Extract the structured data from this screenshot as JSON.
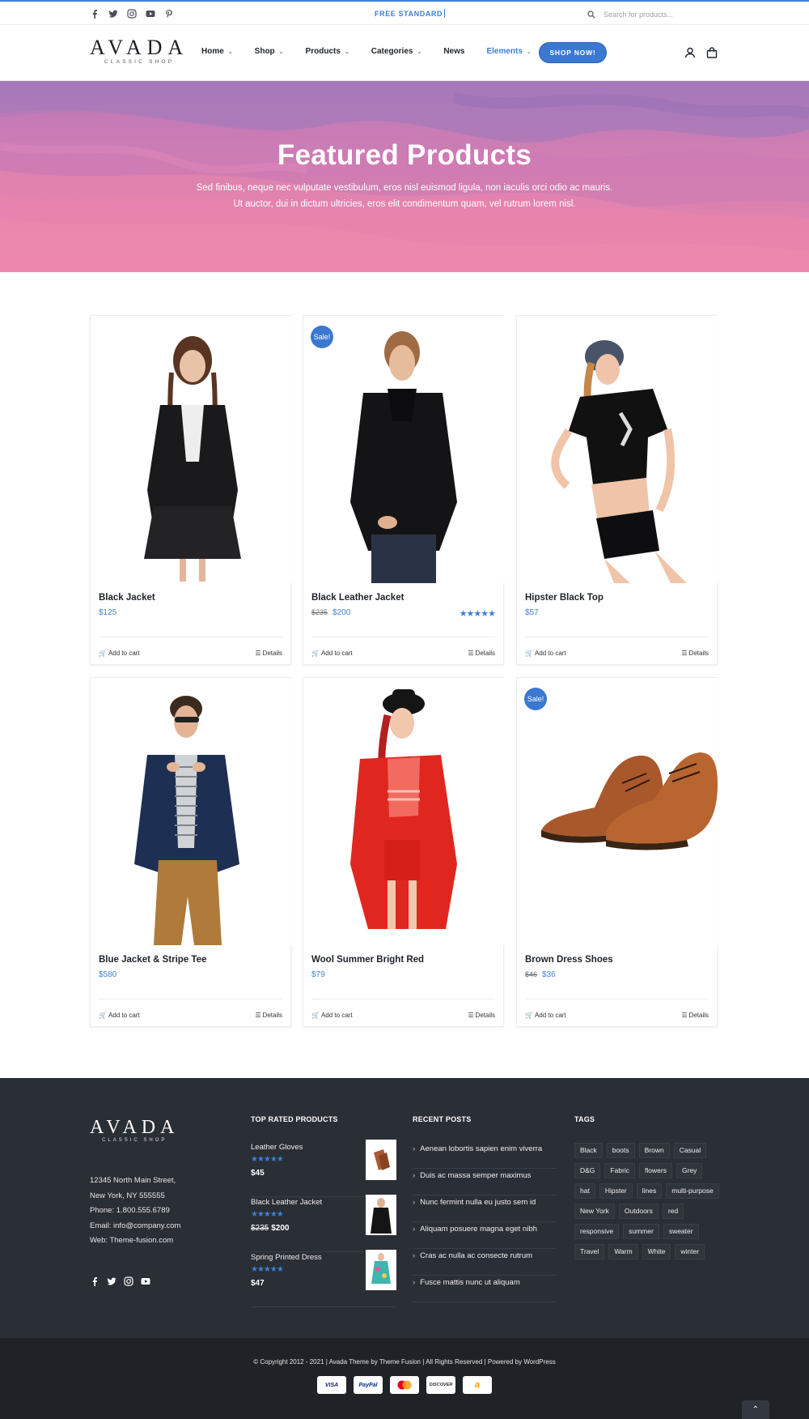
{
  "topbar": {
    "social_icons": [
      "facebook-icon",
      "twitter-icon",
      "instagram-icon",
      "youtube-icon",
      "pinterest-icon"
    ],
    "promo": "FREE STANDARD",
    "search_placeholder": "Search for products..."
  },
  "header": {
    "logo_main": "AVADA",
    "logo_sub": "CLASSIC SHOP",
    "nav": [
      {
        "label": "Home",
        "dropdown": true
      },
      {
        "label": "Shop",
        "dropdown": true
      },
      {
        "label": "Products",
        "dropdown": true
      },
      {
        "label": "Categories",
        "dropdown": true
      },
      {
        "label": "News",
        "dropdown": false
      },
      {
        "label": "Elements",
        "dropdown": true,
        "active": true
      }
    ],
    "cta": "SHOP NOW!",
    "icons": [
      "user-icon",
      "shopping-bag-icon"
    ]
  },
  "hero": {
    "title": "Featured Products",
    "line1": "Sed finibus, neque nec vulputate vestibulum, eros nisl euismod ligula, non iaculis orci odio ac mauris.",
    "line2": "Ut auctor, dui in dictum ultricies, eros elit condimentum quam, vel rutrum lorem nisl."
  },
  "products": [
    {
      "name": "Black Jacket",
      "price": "$125",
      "old_price": "",
      "sale": false,
      "rating": 0
    },
    {
      "name": "Black Leather Jacket",
      "price": "$200",
      "old_price": "$235",
      "sale": true,
      "rating": 5
    },
    {
      "name": "Hipster Black Top",
      "price": "$57",
      "old_price": "",
      "sale": false,
      "rating": 0
    },
    {
      "name": "Blue Jacket & Stripe Tee",
      "price": "$580",
      "old_price": "",
      "sale": false,
      "rating": 0
    },
    {
      "name": "Wool Summer Bright Red",
      "price": "$79",
      "old_price": "",
      "sale": false,
      "rating": 0
    },
    {
      "name": "Brown Dress Shoes",
      "price": "$36",
      "old_price": "$46",
      "sale": true,
      "rating": 0
    }
  ],
  "product_labels": {
    "sale": "Sale!",
    "add_to_cart": "Add to cart",
    "details": "Details"
  },
  "footer": {
    "logo_main": "AVADA",
    "logo_sub": "CLASSIC SHOP",
    "address": [
      "12345 North Main Street,",
      "New York, NY 555555",
      "Phone: 1.800.555.6789",
      "Email: info@company.com",
      "Web: Theme-fusion.com"
    ],
    "social_icons": [
      "facebook-icon",
      "twitter-icon",
      "instagram-icon",
      "youtube-icon"
    ],
    "top_rated_title": "TOP RATED PRODUCTS",
    "top_rated": [
      {
        "name": "Leather Gloves",
        "rating": 5,
        "price": "$45",
        "old_price": ""
      },
      {
        "name": "Black Leather Jacket",
        "rating": 5,
        "price": "$200",
        "old_price": "$235"
      },
      {
        "name": "Spring Printed Dress",
        "rating": 5,
        "price": "$47",
        "old_price": ""
      }
    ],
    "recent_title": "RECENT POSTS",
    "recent_posts": [
      "Aenean lobortis sapien enim viverra",
      "Duis ac massa semper maximus",
      "Nunc fermint nulla eu justo sem id",
      "Aliquam posuere magna eget nibh",
      "Cras ac nulla ac consecte rutrum",
      "Fusce mattis nunc ut aliquam"
    ],
    "tags_title": "TAGS",
    "tags": [
      "Black",
      "boots",
      "Brown",
      "Casual",
      "D&G",
      "Fabric",
      "flowers",
      "Grey",
      "hat",
      "Hipster",
      "lines",
      "multi-purpose",
      "New York",
      "Outdoors",
      "red",
      "responsive",
      "summer",
      "sweater",
      "Travel",
      "Warm",
      "White",
      "winter"
    ]
  },
  "bottom": {
    "copyright": "© Copyright 2012 - 2021   |   Avada Theme by Theme Fusion   |   All Rights Reserved   |   Powered by WordPress",
    "payments": [
      {
        "label": "VISA",
        "color": "#1a1f71"
      },
      {
        "label": "PayPal",
        "color": "#003087"
      },
      {
        "label": "",
        "color": "#eb001b"
      },
      {
        "label": "DISCOVER",
        "color": "#333333"
      },
      {
        "label": "a",
        "color": "#ff9900"
      }
    ]
  },
  "colors": {
    "accent": "#3f7fd5",
    "footer_bg": "#2a2e35",
    "bottom_bg": "#1f2227"
  }
}
